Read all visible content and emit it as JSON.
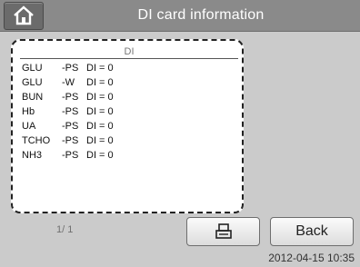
{
  "header": {
    "title": "DI card information",
    "home_icon": "home-icon"
  },
  "panel": {
    "column_header": "DI",
    "rows": [
      {
        "name": "GLU",
        "type": "-PS",
        "value": "DI = 0"
      },
      {
        "name": "GLU",
        "type": "-W",
        "value": "DI = 0"
      },
      {
        "name": "BUN",
        "type": "-PS",
        "value": "DI = 0"
      },
      {
        "name": "Hb",
        "type": "-PS",
        "value": "DI = 0"
      },
      {
        "name": "UA",
        "type": "-PS",
        "value": "DI = 0"
      },
      {
        "name": "TCHO",
        "type": "-PS",
        "value": "DI = 0"
      },
      {
        "name": "NH3",
        "type": "-PS",
        "value": "DI = 0"
      }
    ]
  },
  "footer": {
    "page_indicator": "1/ 1",
    "print_icon": "printer-icon",
    "back_label": "Back",
    "datetime": "2012-04-15 10:35"
  }
}
